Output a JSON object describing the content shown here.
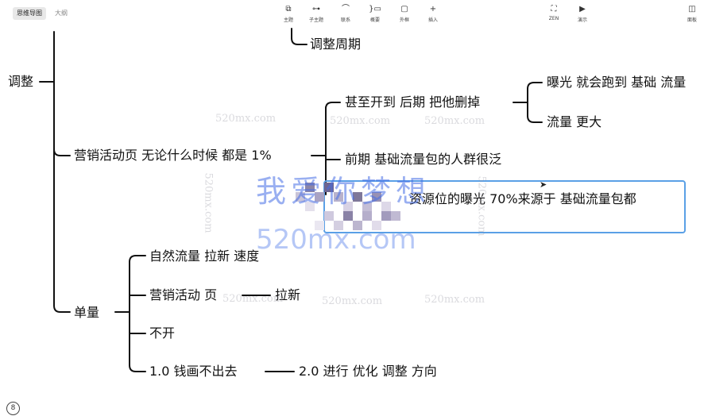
{
  "toolbar": {
    "tabs": [
      {
        "label": "思维导图",
        "active": true
      },
      {
        "label": "大纲",
        "active": false
      }
    ],
    "tools": [
      {
        "id": "topic",
        "label": "主题",
        "icon": "topic-icon"
      },
      {
        "id": "subtopic",
        "label": "子主题",
        "icon": "subtopic-icon"
      },
      {
        "id": "relation",
        "label": "联系",
        "icon": "relation-icon"
      },
      {
        "id": "summary",
        "label": "概要",
        "icon": "summary-icon"
      },
      {
        "id": "boundary",
        "label": "外框",
        "icon": "boundary-icon"
      },
      {
        "id": "insert",
        "label": "插入",
        "icon": "plus-icon"
      }
    ],
    "right_tools": [
      {
        "id": "zen",
        "label": "ZEN",
        "icon": "fullscreen-icon"
      },
      {
        "id": "present",
        "label": "演示",
        "icon": "play-icon"
      },
      {
        "id": "panel",
        "label": "面板",
        "icon": "panel-icon"
      }
    ]
  },
  "mindmap": {
    "nodes": {
      "adjust_cycle": "调整周期",
      "adjust": "调整",
      "marketing_page": "营销活动页  无论什么时候  都是  1%",
      "even_later": "甚至开到  后期  把他删掉",
      "exposure": "曝光  就会跑到  基础  流量",
      "more_traffic": "流量  更大",
      "early": "前期  基础流量包的人群很泛",
      "resource": "资源位的曝光  70%来源于  基础流量包都",
      "single": "单量",
      "natural": "自然流量  拉新  速度",
      "marketing_activity": "营销活动  页",
      "pull_new": "拉新",
      "not_open": "不开",
      "money": "1.0  钱画不出去",
      "v2": "2.0  进行  优化  调整  方向"
    }
  },
  "watermark": {
    "big_text": "我爱你梦想",
    "url_text": "520mx.com",
    "small_text": "520mx.com"
  },
  "page_indicator": "8"
}
